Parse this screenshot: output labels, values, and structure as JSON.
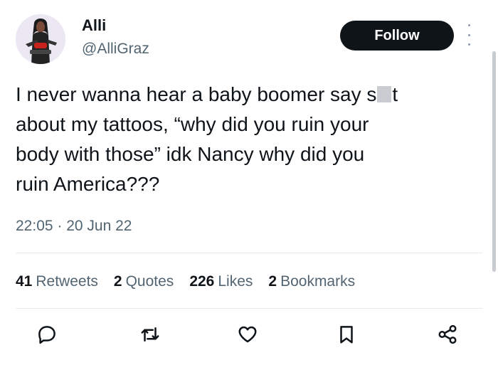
{
  "user": {
    "display_name": "Alli",
    "handle": "@AlliGraz",
    "avatar_icon": "profile-photo"
  },
  "header": {
    "follow_label": "Follow",
    "more_icon": "more-options-icon"
  },
  "tweet": {
    "text_part1": "I never wanna hear a baby boomer say s",
    "text_part2": "t\nabout my tattoos, “why did you ruin your\nbody with those” idk Nancy why did you\nruin America???",
    "timestamp": "22:05 · 20 Jun 22"
  },
  "stats": [
    {
      "count": "41",
      "label": "Retweets"
    },
    {
      "count": "2",
      "label": "Quotes"
    },
    {
      "count": "226",
      "label": "Likes"
    },
    {
      "count": "2",
      "label": "Bookmarks"
    }
  ],
  "actions": {
    "icons": [
      "reply-icon",
      "retweet-icon",
      "like-icon",
      "bookmark-icon",
      "share-icon"
    ]
  },
  "colors": {
    "text_primary": "#0f1419",
    "text_secondary": "#536471",
    "follow_bg": "#0f1419",
    "divider": "#e6e9ec"
  }
}
